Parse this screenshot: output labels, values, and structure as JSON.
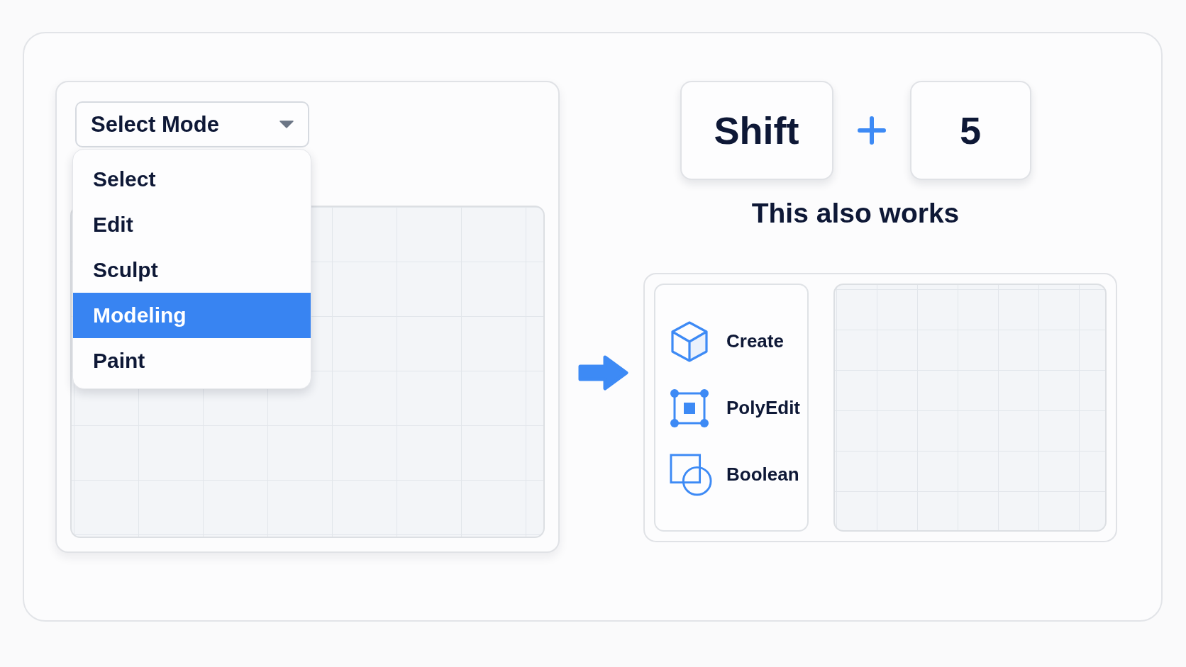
{
  "mode_selector": {
    "label": "Select Mode",
    "expanded": true,
    "options": [
      {
        "label": "Select",
        "selected": false
      },
      {
        "label": "Edit",
        "selected": false
      },
      {
        "label": "Sculpt",
        "selected": false
      },
      {
        "label": "Modeling",
        "selected": true
      },
      {
        "label": "Paint",
        "selected": false
      }
    ]
  },
  "shortcut": {
    "keys": [
      "Shift",
      "5"
    ],
    "caption": "This also works"
  },
  "tool_panel": {
    "tools": [
      {
        "label": "Create",
        "kind": "cube"
      },
      {
        "label": "PolyEdit",
        "kind": "vertex-square"
      },
      {
        "label": "Boolean",
        "kind": "boolean"
      }
    ]
  }
}
